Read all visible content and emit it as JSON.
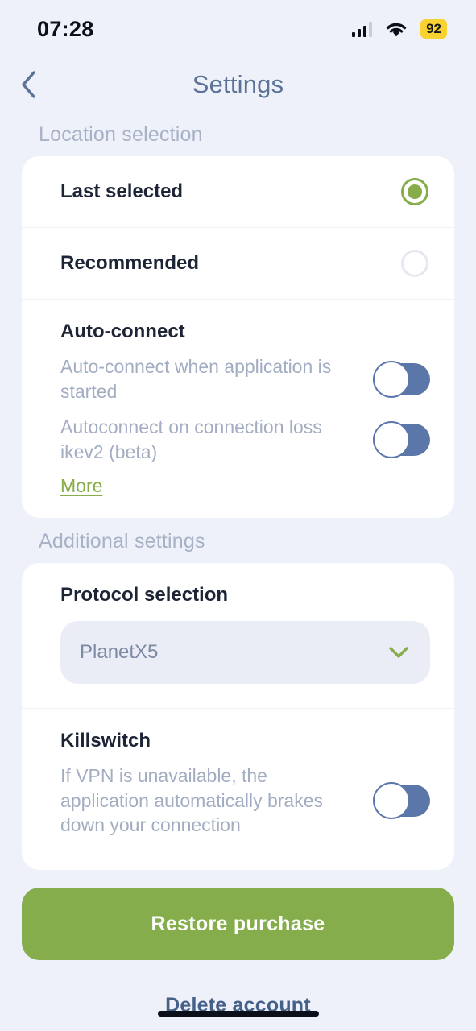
{
  "status_bar": {
    "time": "07:28",
    "signal_icon": "cellular-signal-icon",
    "wifi_icon": "wifi-icon",
    "battery_level": "92"
  },
  "nav": {
    "back_icon": "chevron-left-icon",
    "title": "Settings"
  },
  "sections": {
    "location": {
      "header": "Location selection",
      "options": [
        {
          "label": "Last selected",
          "selected": true
        },
        {
          "label": "Recommended",
          "selected": false
        }
      ],
      "auto_connect": {
        "title": "Auto-connect",
        "rows": [
          {
            "text": "Auto-connect when application is started",
            "toggle_on": false
          },
          {
            "text": "Autoconnect on connection loss ikev2 (beta)",
            "toggle_on": false
          }
        ],
        "more_link": "More"
      }
    },
    "additional": {
      "header": "Additional settings",
      "protocol": {
        "title": "Protocol selection",
        "selected_value": "PlanetX5",
        "chevron_icon": "chevron-down-icon"
      },
      "killswitch": {
        "title": "Killswitch",
        "description": "If VPN is unavailable, the application automatically brakes down your connection",
        "toggle_on": false
      }
    }
  },
  "actions": {
    "restore_purchase": "Restore purchase",
    "delete_account": "Delete account"
  },
  "colors": {
    "accent_green": "#85ad4c",
    "toggle_blue": "#5b76a8",
    "background": "#eef1f9",
    "battery_yellow": "#f8d231",
    "title_slate": "#5c7397"
  }
}
